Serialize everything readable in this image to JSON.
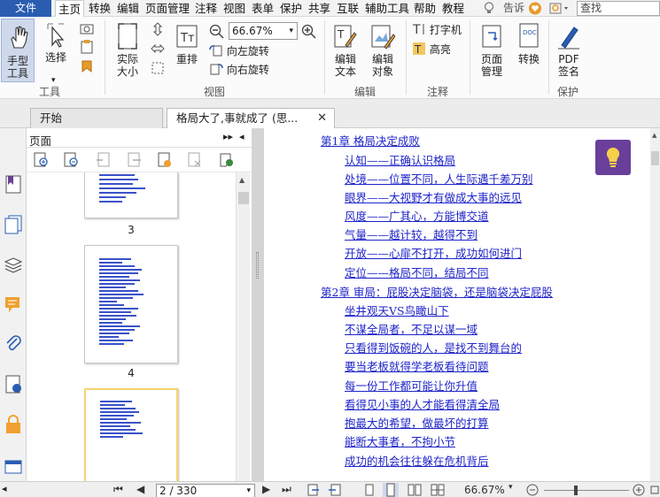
{
  "menubar": {
    "file": "文件",
    "items": [
      "主页",
      "转换",
      "编辑",
      "页面管理",
      "注释",
      "视图",
      "表单",
      "保护",
      "共享",
      "互联",
      "辅助工具",
      "帮助",
      "教程"
    ],
    "active": "主页",
    "tell_me": "告诉",
    "search_placeholder": "查找"
  },
  "ribbon": {
    "hand_tool": "手型\n工具",
    "select": "选择",
    "actual_size": "实际\n大小",
    "reflow": "重排",
    "zoom_value": "66.67%",
    "rotate_left": "向左旋转",
    "rotate_right": "向右旋转",
    "edit_text": "编辑\n文本",
    "edit_object": "编辑\n对象",
    "typewriter": "打字机",
    "highlight": "高亮",
    "page_manage": "页面\n管理",
    "convert": "转换",
    "pdf_sign": "PDF\n签名",
    "groups": {
      "tools": "工具",
      "view": "视图",
      "edit": "编辑",
      "comment": "注释",
      "protect": "保护"
    }
  },
  "tabs": [
    {
      "label": "开始"
    },
    {
      "label": "格局大了,事就成了 (思..."
    }
  ],
  "panel": {
    "title": "页面",
    "pages": [
      "3",
      "4"
    ]
  },
  "document": {
    "lines": [
      "第1章 格局决定成败",
      "认知——正确认识格局",
      "处境——位置不同，人生际遇千差万别",
      "眼界——大视野才有做成大事的远见",
      "风度——广其心，方能博交道",
      "气量——越计较，越得不到",
      "开放——心扉不打开，成功如何进门",
      "定位——格局不同，结局不同",
      "第2章 审局：屁股决定脑袋，还是脑袋决定屁股",
      "坐井观天VS鸟瞰山下",
      "不谋全局者，不足以谋一域",
      "只看得到饭碗的人，是找不到舞台的",
      "要当老板就得学老板看待问题",
      "每一份工作都可能让你升值",
      "看得见小事的人才能看得清全局",
      "抱最大的希望，做最坏的打算",
      "能断大事者，不拘小节",
      "成功的机会往往躲在危机背后"
    ]
  },
  "statusbar": {
    "page_field": "2 / 330",
    "zoom": "66.67%"
  },
  "colors": {
    "file_tab": "#2a5db0",
    "link": "#1f25c8",
    "bulb": "#6a3f9a",
    "selected_thumb": "#f7d370"
  }
}
